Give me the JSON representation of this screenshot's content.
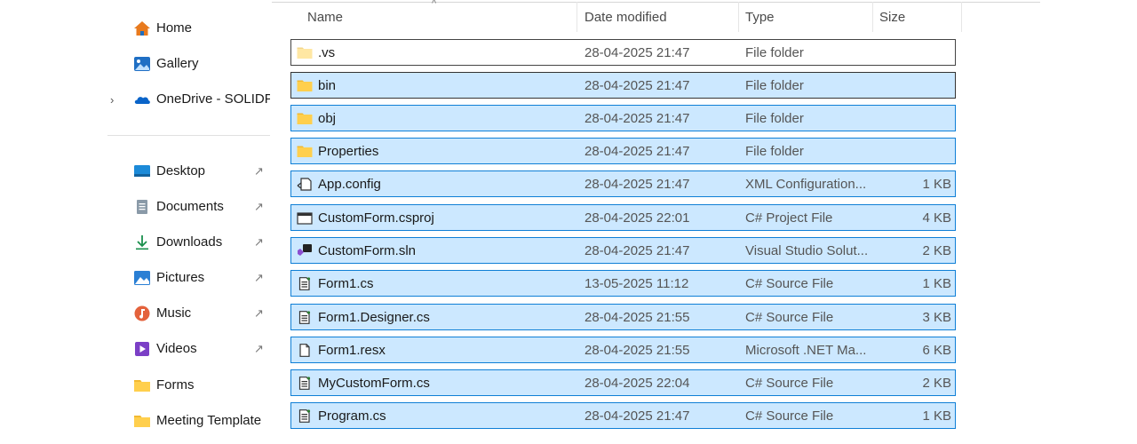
{
  "nav": {
    "items": [
      {
        "label": "Home",
        "icon": "home-icon",
        "color": "#e87a1e"
      },
      {
        "label": "Gallery",
        "icon": "gallery-icon",
        "color": "#1f6fc4"
      },
      {
        "label": "OneDrive - SOLIDPI",
        "icon": "onedrive-cloud-icon",
        "color": "#0a64c9",
        "chevron": "›"
      },
      {
        "label": "Desktop",
        "icon": "desktop-icon",
        "color": "#1c8ad8",
        "pin": "📌"
      },
      {
        "label": "Documents",
        "icon": "documents-icon",
        "color": "#8a9aa8",
        "pin": "📌"
      },
      {
        "label": "Downloads",
        "icon": "downloads-arrow-icon",
        "color": "#1a8f4c",
        "pin": "📌"
      },
      {
        "label": "Pictures",
        "icon": "pictures-icon",
        "color": "#2a7fd4",
        "pin": "📌"
      },
      {
        "label": "Music",
        "icon": "music-icon",
        "color": "#e4623c",
        "pin": "📌"
      },
      {
        "label": "Videos",
        "icon": "videos-icon",
        "color": "#7b3fc6",
        "pin": "📌"
      },
      {
        "label": "Forms",
        "icon": "folder-icon",
        "color": "#ffcf4d"
      },
      {
        "label": "Meeting Template",
        "icon": "folder-icon",
        "color": "#ffcf4d"
      }
    ]
  },
  "columns": {
    "name": "Name",
    "date": "Date modified",
    "type": "Type",
    "size": "Size",
    "sort_caret": "^"
  },
  "files": [
    {
      "name": ".vs",
      "date": "28-04-2025 21:47",
      "type": "File folder",
      "size": "",
      "icon": "folder-icon",
      "selected": false
    },
    {
      "name": "bin",
      "date": "28-04-2025 21:47",
      "type": "File folder",
      "size": "",
      "icon": "folder-icon",
      "selected": true
    },
    {
      "name": "obj",
      "date": "28-04-2025 21:47",
      "type": "File folder",
      "size": "",
      "icon": "folder-icon",
      "selected": true
    },
    {
      "name": "Properties",
      "date": "28-04-2025 21:47",
      "type": "File folder",
      "size": "",
      "icon": "folder-icon",
      "selected": true
    },
    {
      "name": "App.config",
      "date": "28-04-2025 21:47",
      "type": "XML Configuration...",
      "size": "1 KB",
      "icon": "config-file-icon",
      "selected": true
    },
    {
      "name": "CustomForm.csproj",
      "date": "28-04-2025 22:01",
      "type": "C# Project File",
      "size": "4 KB",
      "icon": "csproj-file-icon",
      "selected": true
    },
    {
      "name": "CustomForm.sln",
      "date": "28-04-2025 21:47",
      "type": "Visual Studio Solut...",
      "size": "2 KB",
      "icon": "solution-file-icon",
      "selected": true
    },
    {
      "name": "Form1.cs",
      "date": "13-05-2025 11:12",
      "type": "C# Source File",
      "size": "1 KB",
      "icon": "cs-file-icon",
      "selected": true
    },
    {
      "name": "Form1.Designer.cs",
      "date": "28-04-2025 21:55",
      "type": "C# Source File",
      "size": "3 KB",
      "icon": "cs-file-icon",
      "selected": true
    },
    {
      "name": "Form1.resx",
      "date": "28-04-2025 21:55",
      "type": "Microsoft .NET Ma...",
      "size": "6 KB",
      "icon": "resx-file-icon",
      "selected": true
    },
    {
      "name": "MyCustomForm.cs",
      "date": "28-04-2025 22:04",
      "type": "C# Source File",
      "size": "2 KB",
      "icon": "cs-file-icon",
      "selected": true
    },
    {
      "name": "Program.cs",
      "date": "28-04-2025 21:47",
      "type": "C# Source File",
      "size": "1 KB",
      "icon": "cs-file-icon",
      "selected": true
    }
  ],
  "colors": {
    "selection_bg": "#cce8ff",
    "selection_border": "#0f7fd6"
  }
}
